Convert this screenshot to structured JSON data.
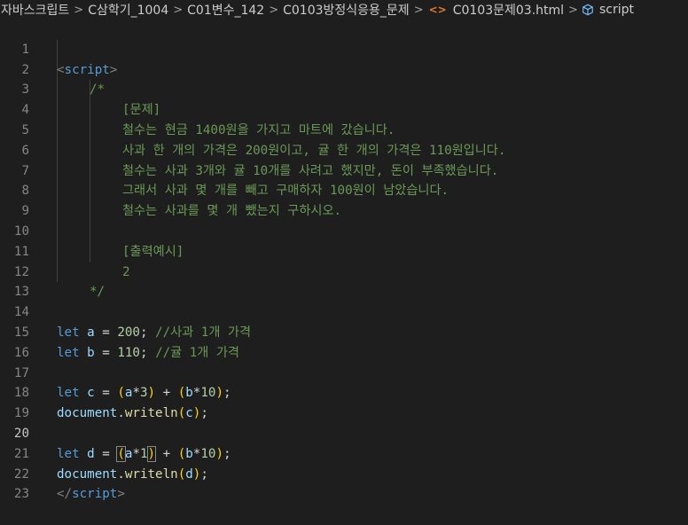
{
  "breadcrumb": {
    "items": [
      "자바스크립트",
      "C삼학기_1004",
      "C01변수_142",
      "C0103방정식응용_문제"
    ],
    "file": "C0103문제03.html",
    "symbol": "script",
    "file_icon": "<>"
  },
  "editor": {
    "line_numbers": [
      "1",
      "2",
      "3",
      "4",
      "5",
      "6",
      "7",
      "8",
      "9",
      "10",
      "11",
      "12",
      "13",
      "14",
      "15",
      "16",
      "17",
      "18",
      "19",
      "20",
      "21",
      "22",
      "23"
    ],
    "active_line": "20",
    "lines": {
      "l1_open": "<",
      "l1_tag": "script",
      "l1_close": ">",
      "l2": "/*",
      "l3": "[문제]",
      "l4": "철수는 현금 1400원을 가지고 마트에 갔습니다.",
      "l5": "사과 한 개의 가격은 200원이고, 귤 한 개의 가격은 110원입니다.",
      "l6": "철수는 사과 3개와 귤 10개를 사려고 했지만, 돈이 부족했습니다.",
      "l7": "그래서 사과 몇 개를 빼고 구매하자 100원이 남았습니다.",
      "l8": "철수는 사과를 몇 개 뺐는지 구하시오.",
      "l10": "[출력예시]",
      "l11": "2",
      "l12": "*/",
      "let": "let",
      "eq": " = ",
      "semi": ";",
      "a": "a",
      "b": "b",
      "c": "c",
      "d": "d",
      "v200": "200",
      "v110": "110",
      "v3": "3",
      "v10": "10",
      "v1": "1",
      "cm14": "//사과 1개 가격",
      "cm15": "//귤 1개 가격",
      "lp": "(",
      "rp": ")",
      "mul": "*",
      "plus": " + ",
      "document": "document",
      "dot": ".",
      "writeln": "writeln",
      "l22_open": "</",
      "l22_tag": "script",
      "l22_close": ">"
    }
  }
}
